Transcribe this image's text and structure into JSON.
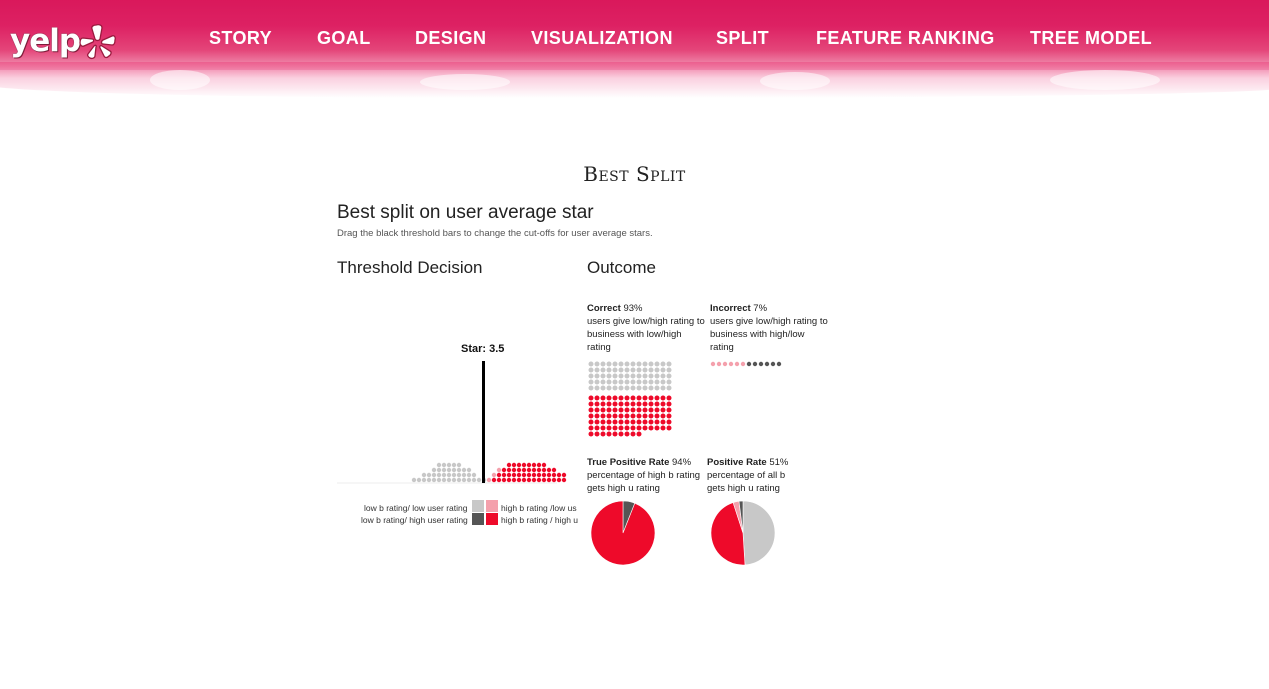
{
  "brand": {
    "logo_text": "yelp",
    "accent": "#dd2163"
  },
  "nav": {
    "items": [
      {
        "label": "STORY"
      },
      {
        "label": "GOAL"
      },
      {
        "label": "DESIGN"
      },
      {
        "label": "VISUALIZATION"
      },
      {
        "label": "SPLIT"
      },
      {
        "label": "FEATURE RANKING"
      },
      {
        "label": "TREE MODEL"
      }
    ]
  },
  "section": {
    "title": "Best Split",
    "heading": "Best split on user average star",
    "subtitle": "Drag the black threshold bars to change the cut-offs for user average stars."
  },
  "threshold": {
    "heading": "Threshold Decision",
    "star_label": "Star: 3.5",
    "star_value": 3.5,
    "legend": {
      "low_low": "low b rating/ low user rating",
      "low_high": "low b rating/ high user rating",
      "high_low": "high b rating /low us",
      "high_high": "high b rating / high u"
    },
    "colors": {
      "low_low": "#c8c8c8",
      "low_high": "#555555",
      "high_low": "#f4a0ac",
      "high_high": "#ee0a2a"
    }
  },
  "outcome": {
    "heading": "Outcome",
    "correct": {
      "label": "Correct",
      "value": "93%",
      "desc": "users give low/high rating to business with low/high rating"
    },
    "incorrect": {
      "label": "Incorrect",
      "value": "7%",
      "desc": "users give low/high rating to business with high/low rating"
    },
    "tpr": {
      "label": "True Positive Rate",
      "value": "94%",
      "desc": "percentage of high b rating gets high u rating",
      "fraction": 0.94
    },
    "pos_rate": {
      "label": "Positive Rate",
      "value": "51%",
      "desc": "percentage of all b gets high u rating",
      "fraction": 0.51
    }
  }
}
